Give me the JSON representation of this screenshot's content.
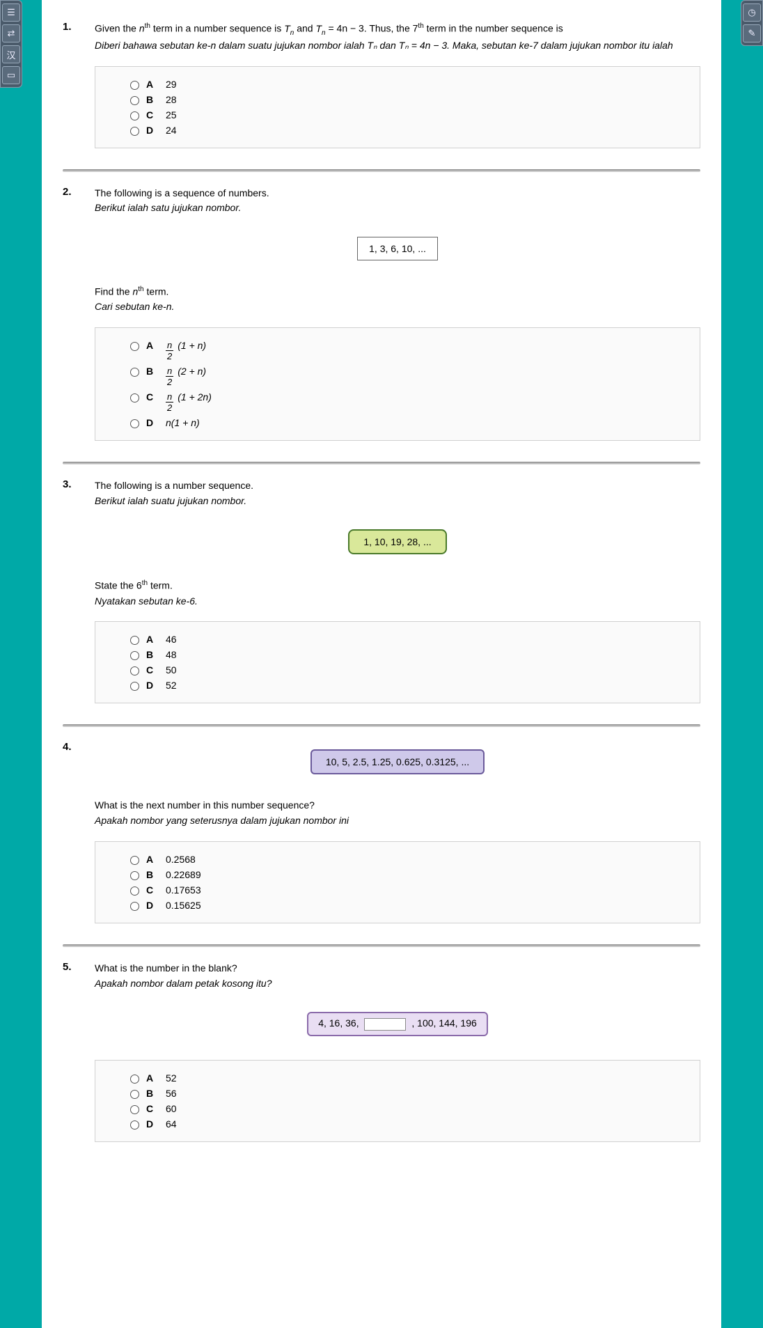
{
  "toolbar_left": [
    "doc",
    "swap",
    "translate",
    "present"
  ],
  "toolbar_right": [
    "clock",
    "notes"
  ],
  "questions": [
    {
      "num": "1.",
      "text_en_pre": "Given the ",
      "nth": "n",
      "th": "th",
      "text_en_mid": " term in a number sequence is ",
      "Tn": "T",
      "Tn_sub": "n",
      "text_en_and": " and ",
      "eq": " = 4n − 3. Thus, the 7",
      "text_en_post": " term in the number sequence is",
      "text_ms": "Diberi bahawa sebutan ke-n dalam suatu jujukan nombor ialah Tₙ dan Tₙ = 4n − 3. Maka, sebutan ke-7 dalam jujukan nombor itu ialah",
      "opts": [
        {
          "l": "A",
          "v": "29"
        },
        {
          "l": "B",
          "v": "28"
        },
        {
          "l": "C",
          "v": "25"
        },
        {
          "l": "D",
          "v": "24"
        }
      ]
    },
    {
      "num": "2.",
      "text_en": "The following is a sequence of numbers.",
      "text_ms": "Berikut ialah satu jujukan nombor.",
      "seq": "1, 3, 6, 10, ...",
      "prompt_en_pre": "Find the ",
      "prompt_en_post": " term.",
      "prompt_ms": "Cari sebutan ke-n.",
      "opts": [
        {
          "l": "A",
          "frac_num": "n",
          "frac_den": "2",
          "tail": "(1 + n)"
        },
        {
          "l": "B",
          "frac_num": "n",
          "frac_den": "2",
          "tail": "(2 + n)"
        },
        {
          "l": "C",
          "frac_num": "n",
          "frac_den": "2",
          "tail": "(1 + 2n)"
        },
        {
          "l": "D",
          "plain": "n(1 + n)"
        }
      ]
    },
    {
      "num": "3.",
      "text_en": "The following is a number sequence.",
      "text_ms": "Berikut ialah suatu jujukan nombor.",
      "seq": "1, 10, 19, 28, ...",
      "prompt_en_pre": "State the 6",
      "prompt_en_post": " term.",
      "prompt_ms": "Nyatakan sebutan ke-6.",
      "opts": [
        {
          "l": "A",
          "v": "46"
        },
        {
          "l": "B",
          "v": "48"
        },
        {
          "l": "C",
          "v": "50"
        },
        {
          "l": "D",
          "v": "52"
        }
      ]
    },
    {
      "num": "4.",
      "seq": "10, 5, 2.5, 1.25, 0.625, 0.3125, ...",
      "prompt_en": "What is the next number in this number sequence?",
      "prompt_ms": "Apakah nombor yang seterusnya dalam jujukan nombor ini",
      "opts": [
        {
          "l": "A",
          "v": "0.2568"
        },
        {
          "l": "B",
          "v": "0.22689"
        },
        {
          "l": "C",
          "v": "0.17653"
        },
        {
          "l": "D",
          "v": "0.15625"
        }
      ]
    },
    {
      "num": "5.",
      "text_en": "What is the number in the blank?",
      "text_ms": "Apakah nombor dalam petak kosong itu?",
      "seq_pre": "4, 16, 36,",
      "seq_post": ", 100, 144, 196",
      "opts": [
        {
          "l": "A",
          "v": "52"
        },
        {
          "l": "B",
          "v": "56"
        },
        {
          "l": "C",
          "v": "60"
        },
        {
          "l": "D",
          "v": "64"
        }
      ]
    }
  ]
}
